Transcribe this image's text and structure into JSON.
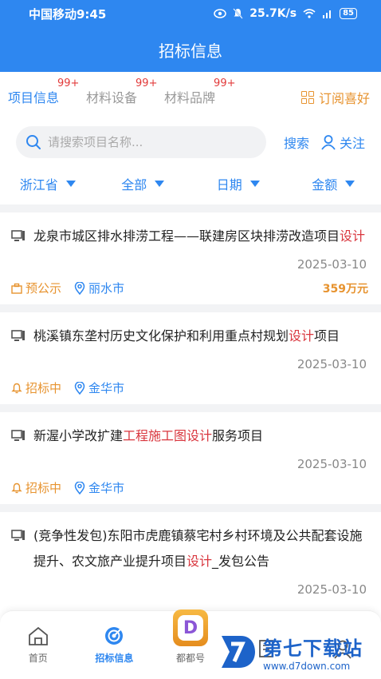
{
  "status_bar": {
    "carrier_time": "中国移动9:45",
    "speed": "25.7K/s",
    "battery": "85"
  },
  "app_bar": {
    "title": "招标信息"
  },
  "top_tabs": [
    {
      "label": "项目信息",
      "badge": "99+"
    },
    {
      "label": "材料设备",
      "badge": "99+"
    },
    {
      "label": "材料品牌",
      "badge": "99+"
    }
  ],
  "subscribe_label": "订阅喜好",
  "search": {
    "placeholder": "请搜索项目名称...",
    "button_label": "搜索",
    "follow_label": "关注"
  },
  "filters": [
    {
      "label": "浙江省"
    },
    {
      "label": "全部"
    },
    {
      "label": "日期"
    },
    {
      "label": "金额"
    }
  ],
  "projects": [
    {
      "title_pre": "龙泉市城区排水排涝工程——联建房区块排涝改造项目",
      "title_hl": "设计",
      "title_post": "",
      "date": "2025-03-10",
      "status": "预公示",
      "city": "丽水市",
      "amount": "359万元"
    },
    {
      "title_pre": "桃溪镇东垄村历史文化保护和利用重点村规划",
      "title_hl": "设计",
      "title_post": "项目",
      "date": "2025-03-10",
      "status": "招标中",
      "city": "金华市",
      "amount": ""
    },
    {
      "title_pre": "新渥小学改扩建",
      "title_hl": "工程施工图设计",
      "title_post": "服务项目",
      "date": "2025-03-10",
      "status": "招标中",
      "city": "金华市",
      "amount": ""
    },
    {
      "title_pre": "(竞争性发包)东阳市虎鹿镇蔡宅村乡村环境及公共配套设施提升、农文旅产业提升项目",
      "title_hl": "设计",
      "title_post": "_发包公告",
      "date": "2025-03-10",
      "status": "",
      "city": "",
      "amount": ""
    }
  ],
  "bottom_nav": [
    {
      "label": "首页"
    },
    {
      "label": "招标信息"
    },
    {
      "label": "都都号"
    },
    {
      "label": ""
    },
    {
      "label": ""
    }
  ],
  "watermark": {
    "main": "第七下载站",
    "sub": "www.d7down.com"
  },
  "colors": {
    "primary": "#2e87f0",
    "orange": "#e7932f",
    "highlight": "#d9363e"
  }
}
